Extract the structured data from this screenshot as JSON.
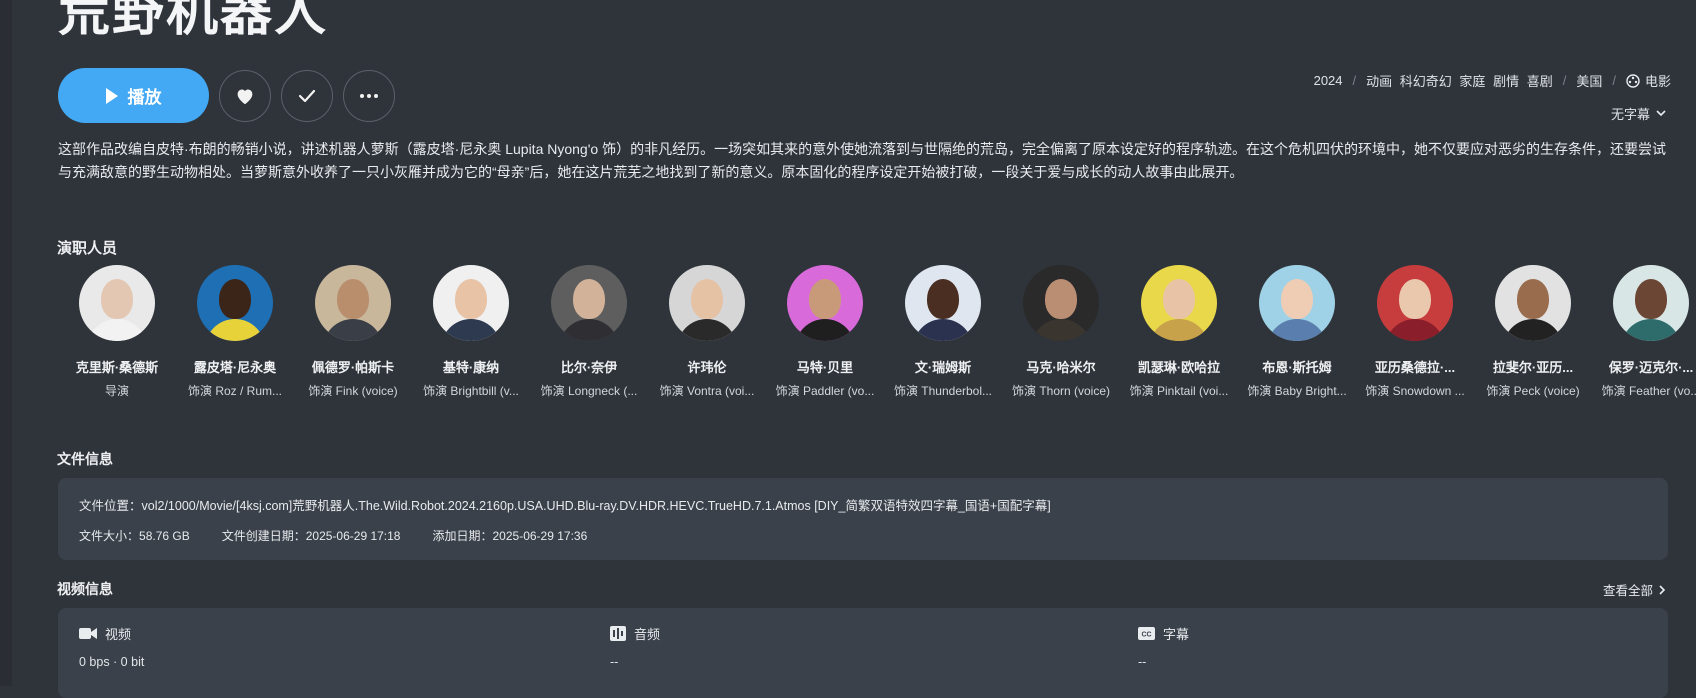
{
  "title": "荒野机器人",
  "actions": {
    "play_label": "播放"
  },
  "meta": {
    "year": "2024",
    "genres": [
      "动画",
      "科幻奇幻",
      "家庭",
      "剧情",
      "喜剧"
    ],
    "country": "美国",
    "type_label": "电影"
  },
  "subtitle_select": "无字幕",
  "overview": "这部作品改编自皮特·布朗的畅销小说，讲述机器人萝斯（露皮塔·尼永奥 Lupita Nyong'o 饰）的非凡经历。一场突如其来的意外使她流落到与世隔绝的荒岛，完全偏离了原本设定好的程序轨迹。在这个危机四伏的环境中，她不仅要应对恶劣的生存条件，还要尝试与充满敌意的野生动物相处。当萝斯意外收养了一只小灰雁并成为它的“母亲”后，她在这片荒芜之地找到了新的意义。原本固化的程序设定开始被打破，一段关于爱与成长的动人故事由此展开。",
  "cast_section_title": "演职人员",
  "cast": [
    {
      "name": "克里斯·桑德斯",
      "role": "导演",
      "skin": "#e3c7b2",
      "bg": "#e9e9e9",
      "cloth": "#f2f2f2"
    },
    {
      "name": "露皮塔·尼永奥",
      "role": "饰演 Roz / Rum...",
      "skin": "#3b2418",
      "bg": "#1e6fb3",
      "cloth": "#e8d23a"
    },
    {
      "name": "佩德罗·帕斯卡",
      "role": "饰演 Fink (voice)",
      "skin": "#b98e6c",
      "bg": "#c9b79c",
      "cloth": "#3a3f47"
    },
    {
      "name": "基特·康纳",
      "role": "饰演 Brightbill (v...",
      "skin": "#e8c3a6",
      "bg": "#f0f0f0",
      "cloth": "#2d3a4f"
    },
    {
      "name": "比尔·奈伊",
      "role": "饰演 Longneck (...",
      "skin": "#d2b39a",
      "bg": "#5e5e5e",
      "cloth": "#2f2f33"
    },
    {
      "name": "许玮伦",
      "role": "饰演 Vontra (voi...",
      "skin": "#e6c2a4",
      "bg": "#d6d6d6",
      "cloth": "#2a2a2a"
    },
    {
      "name": "马特·贝里",
      "role": "饰演 Paddler (vo...",
      "skin": "#c99a7a",
      "bg": "#d96ad9",
      "cloth": "#1f1f1f"
    },
    {
      "name": "文·瑞姆斯",
      "role": "饰演 Thunderbol...",
      "skin": "#4a2e22",
      "bg": "#dfe6ef",
      "cloth": "#2b3250"
    },
    {
      "name": "马克·哈米尔",
      "role": "饰演 Thorn (voice)",
      "skin": "#b98e72",
      "bg": "#2a2a2a",
      "cloth": "#3b3530"
    },
    {
      "name": "凯瑟琳·欧哈拉",
      "role": "饰演 Pinktail (voi...",
      "skin": "#e9c3a6",
      "bg": "#e9d84a",
      "cloth": "#c7a24a"
    },
    {
      "name": "布恩·斯托姆",
      "role": "饰演 Baby Bright...",
      "skin": "#efcdb4",
      "bg": "#9fd2e6",
      "cloth": "#5a7fae"
    },
    {
      "name": "亚历桑德拉·...",
      "role": "饰演 Snowdown ...",
      "skin": "#e9c8ae",
      "bg": "#c73d3d",
      "cloth": "#8a1f2b"
    },
    {
      "name": "拉斐尔·亚历...",
      "role": "饰演 Peck (voice)",
      "skin": "#9a6c4e",
      "bg": "#e2e2e2",
      "cloth": "#222"
    },
    {
      "name": "保罗·迈克尔·...",
      "role": "饰演 Feather (vo...",
      "skin": "#6b4634",
      "bg": "#d9e6e6",
      "cloth": "#2e6b6b"
    }
  ],
  "file_info": {
    "section_title": "文件信息",
    "path_label": "文件位置：",
    "path": "vol2/1000/Movie/[4ksj.com]荒野机器人.The.Wild.Robot.2024.2160p.USA.UHD.Blu-ray.DV.HDR.HEVC.TrueHD.7.1.Atmos [DIY_简繁双语特效四字幕_国语+国配字幕]",
    "size_label": "文件大小：",
    "size": "58.76 GB",
    "created_label": "文件创建日期：",
    "created": "2025-06-29 17:18",
    "added_label": "添加日期：",
    "added": "2025-06-29 17:36"
  },
  "video_info": {
    "section_title": "视频信息",
    "view_all": "查看全部",
    "video_label": "视频",
    "video_value": "0 bps · 0 bit",
    "audio_label": "音频",
    "audio_value": "--",
    "subtitle_label": "字幕",
    "subtitle_value": "--"
  }
}
